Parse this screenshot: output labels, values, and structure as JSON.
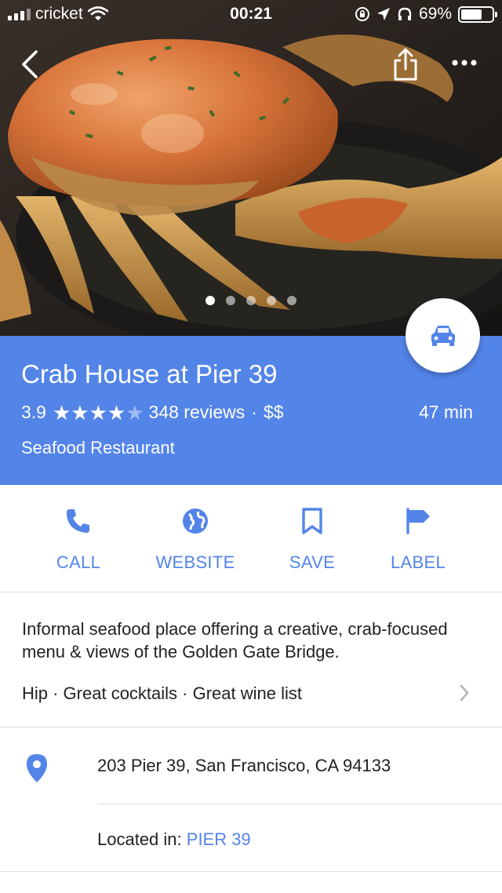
{
  "status_bar": {
    "carrier": "cricket",
    "time": "00:21",
    "battery_percent": "69%",
    "battery_level": 0.69,
    "icons": [
      "signal-icon",
      "wifi-icon",
      "orientation-lock-icon",
      "location-arrow-icon",
      "headphones-icon",
      "battery-icon"
    ]
  },
  "nav": {
    "back_icon": "chevron-left-icon",
    "share_icon": "share-icon",
    "more_icon": "more-horizontal-icon"
  },
  "photo": {
    "subject": "crab-photo",
    "page_count": 5,
    "active_page": 1
  },
  "place": {
    "name": "Crab House at Pier 39",
    "rating": "3.9",
    "rating_value": 3.9,
    "reviews": "348 reviews",
    "separator": "·",
    "price": "$$",
    "category": "Seafood Restaurant",
    "drive_time": "47 min"
  },
  "directions_icon": "car-icon",
  "actions": [
    {
      "label": "CALL",
      "icon": "phone-icon"
    },
    {
      "label": "WEBSITE",
      "icon": "globe-icon"
    },
    {
      "label": "SAVE",
      "icon": "bookmark-icon"
    },
    {
      "label": "LABEL",
      "icon": "flag-icon"
    }
  ],
  "description": {
    "text": "Informal seafood place offering a creative, crab-focused menu & views of the Golden Gate Bridge.",
    "tags": "Hip · Great cocktails · Great wine list"
  },
  "address": {
    "line": "203 Pier 39, San Francisco, CA 94133",
    "located_in_label": "Located in:",
    "located_in_link": "PIER 39"
  },
  "colors": {
    "accent": "#5384e8",
    "header_bg": "#5384e8",
    "text": "#222222",
    "divider": "#dcdcdc"
  }
}
